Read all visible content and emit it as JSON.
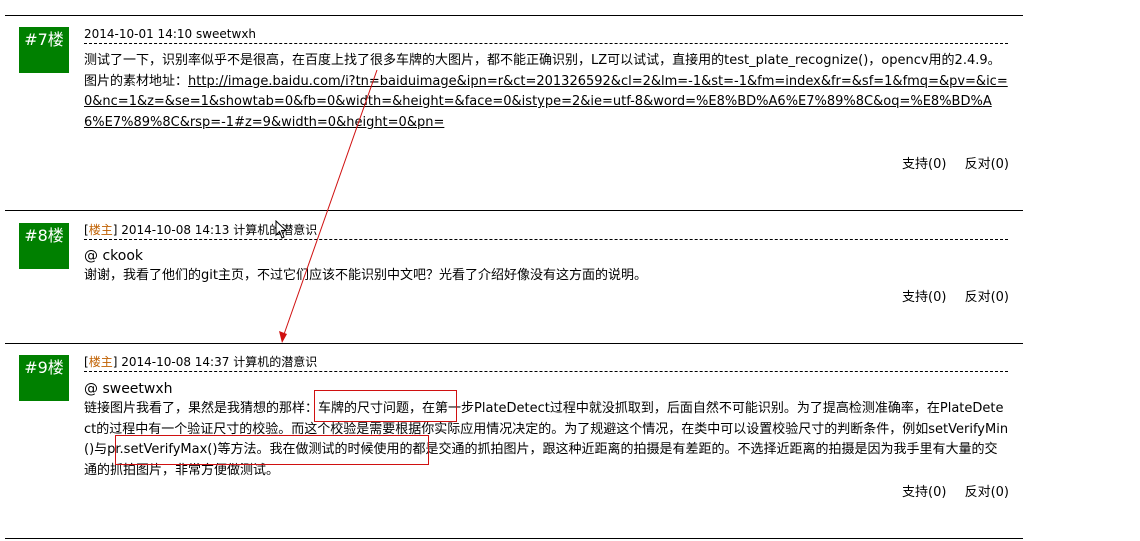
{
  "posts": [
    {
      "floor": "#7楼",
      "is_op": false,
      "date": "2014-10-01 14:10",
      "author": "sweetwxh",
      "text_before_link": "测试了一下，识别率似乎不是很高，在百度上找了很多车牌的大图片，都不能正确识别，LZ可以试试，直接用的test_plate_recognize()，opencv用的2.4.9。图片的素材地址：",
      "link": "http://image.baidu.com/i?tn=baiduimage&ipn=r&ct=201326592&cl=2&lm=-1&st=-1&fm=index&fr=&sf=1&fmq=&pv=&ic=0&nc=1&z=&se=1&showtab=0&fb=0&width=&height=&face=0&istype=2&ie=utf-8&word=%E8%BD%A6%E7%89%8C&oq=%E8%BD%A6%E7%89%8C&rsp=-1#z=9&width=0&height=0&pn=",
      "support": "支持(0)",
      "oppose": "反对(0)"
    },
    {
      "floor": "#8楼",
      "is_op": true,
      "op_label": "楼主",
      "date": "2014-10-08 14:13",
      "author": "计算机的潜意识",
      "reply_to": "@ ckook",
      "text": "谢谢，我看了他们的git主页，不过它们应该不能识别中文吧？光看了介绍好像没有这方面的说明。",
      "support": "支持(0)",
      "oppose": "反对(0)"
    },
    {
      "floor": "#9楼",
      "is_op": true,
      "op_label": "楼主",
      "date": "2014-10-08 14:37",
      "author": "计算机的潜意识",
      "reply_to": "@ sweetwxh",
      "text_p1": "链接图片我看了，果然是我猜想的那样：",
      "text_p2": "车牌的尺寸问题",
      "text_p3": "，在第一步PlateDetect过程中就没抓取到，后面自然不可能识别。为了提高检测准确率，在PlateDetect的过程中有一个验证尺寸的校验。而这个校验是需要根据你实际应用情况决定的。为了规避这个情况，在类中可以设置校验尺寸的判断条件，",
      "text_p4": "例如setVerifyMin()与pr.setVerifyMax()等方法。",
      "text_p5": "我在做测试的时候使用的都是交通的抓拍图片，跟这种近距离的拍摄是有差距的。不选择近距离的拍摄是因为我手里有大量的交通的抓拍图片，非常方便做测试。",
      "support": "支持(0)",
      "oppose": "反对(0)"
    }
  ],
  "colors": {
    "floor_bg": "#008000",
    "op_tag": "#c06000",
    "annotation": "#d01010"
  }
}
